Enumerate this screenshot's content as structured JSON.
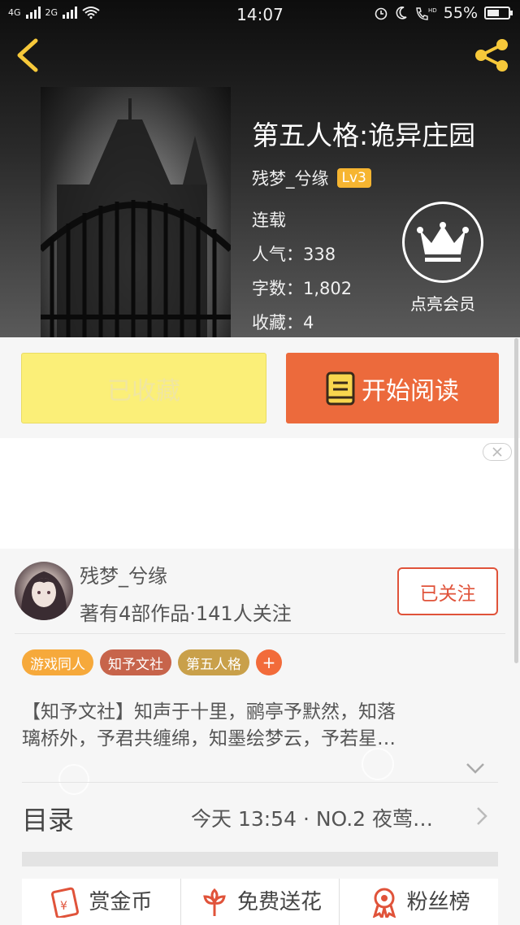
{
  "status_bar": {
    "network_left": "4G",
    "network_right": "2G",
    "time": "14:07",
    "hd_label": "HD",
    "battery": "55%"
  },
  "book": {
    "title": "第五人格:诡异庄园",
    "author": "残梦_兮缘",
    "level": "Lv3",
    "status": "连载",
    "popularity_label": "人气：",
    "popularity": "338",
    "words_label": "字数：",
    "words": "1,802",
    "favorites_label": "收藏：",
    "favorites": "4"
  },
  "vip": {
    "label": "点亮会员"
  },
  "actions": {
    "collected_label": "已收藏",
    "read_label": "开始阅读"
  },
  "author_card": {
    "name": "残梦_兮缘",
    "stats": "著有4部作品·141人关注",
    "follow_label": "已关注"
  },
  "tags": [
    {
      "label": "游戏同人",
      "color": "#f6a93b"
    },
    {
      "label": "知予文社",
      "color": "#c7644b"
    },
    {
      "label": "第五人格",
      "color": "#c9a04a"
    }
  ],
  "tag_add_label": "+",
  "description": [
    "【知予文社】知声于十里，鹂亭予默然，知落",
    "璃桥外，予君共缠绵，知墨绘梦云，予若星…"
  ],
  "toc": {
    "title": "目录",
    "latest": "今天 13:54 · NO.2 夜莺…"
  },
  "bottom_actions": [
    {
      "label": "赏金币",
      "icon": "coin-envelope-icon"
    },
    {
      "label": "免费送花",
      "icon": "flower-icon"
    },
    {
      "label": "粉丝榜",
      "icon": "medal-icon"
    }
  ],
  "colors": {
    "accent_orange": "#ec6a3c",
    "collected_yellow": "#fbef78",
    "follow_red": "#e0533a",
    "level_badge": "#f6b531"
  }
}
